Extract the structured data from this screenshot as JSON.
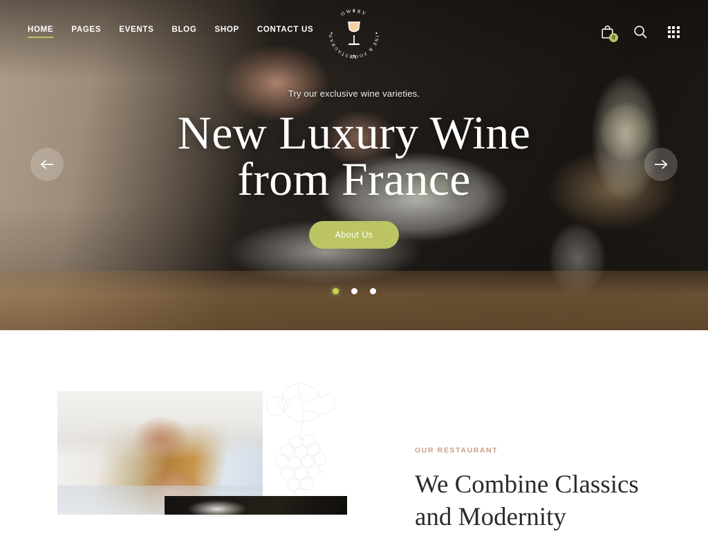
{
  "brand": {
    "logo_top_text": "OWERY",
    "logo_right_text": "WINE & FOOD",
    "logo_left_text": "RESTAURANT",
    "logo_icon": "wine-glass-icon",
    "accent_olive": "#bcc464",
    "accent_tan": "#cb9f84"
  },
  "header": {
    "nav": [
      {
        "label": "HOME",
        "active": true
      },
      {
        "label": "PAGES",
        "active": false
      },
      {
        "label": "EVENTS",
        "active": false
      },
      {
        "label": "BLOG",
        "active": false
      },
      {
        "label": "SHOP",
        "active": false
      },
      {
        "label": "CONTACT US",
        "active": false
      }
    ],
    "actions": {
      "cart_icon": "shopping-bag-icon",
      "cart_count": "0",
      "search_icon": "search-icon",
      "grid_icon": "grid-menu-icon"
    }
  },
  "hero": {
    "subtitle": "Try our exclusive wine varieties.",
    "title_line1": "New Luxury Wine",
    "title_line2": "from France",
    "button_label": "About Us",
    "prev_label": "←",
    "next_label": "→",
    "slides": [
      {
        "index": "1",
        "active": true
      },
      {
        "index": "2",
        "active": false
      },
      {
        "index": "3",
        "active": false
      }
    ]
  },
  "about": {
    "eyebrow": "OUR RESTAURANT",
    "heading_line1": "We Combine Classics",
    "heading_line2": "and Modernity",
    "image_alt": "chef-plating-food-photo",
    "watermark_alt": "grape-cluster-illustration"
  }
}
